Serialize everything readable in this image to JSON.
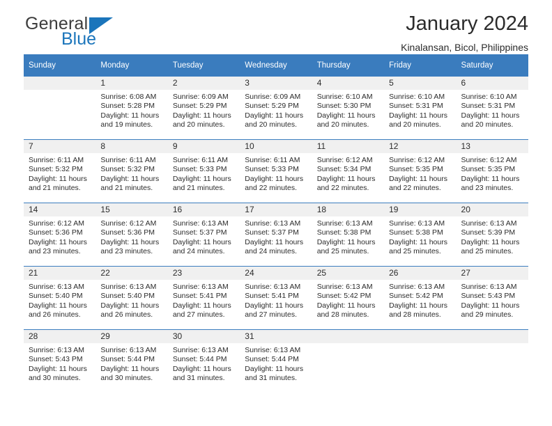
{
  "brand": {
    "word1": "General",
    "word2": "Blue",
    "triangle_icon": "brand-triangle-icon",
    "accent_color": "#1b75bb"
  },
  "header": {
    "title": "January 2024",
    "subtitle": "Kinalansan, Bicol, Philippines"
  },
  "theme": {
    "header_bg": "#3a7cbe",
    "header_text": "#ffffff",
    "daynum_bg": "#f0f0f0",
    "body_text": "#2b2b2b"
  },
  "weekday_headers": [
    "Sunday",
    "Monday",
    "Tuesday",
    "Wednesday",
    "Thursday",
    "Friday",
    "Saturday"
  ],
  "labels": {
    "sunrise_prefix": "Sunrise: ",
    "sunset_prefix": "Sunset: ",
    "daylight_prefix": "Daylight: "
  },
  "weeks": [
    [
      {
        "day": "",
        "sunrise": "",
        "sunset": "",
        "daylight_line1": "",
        "daylight_line2": ""
      },
      {
        "day": "1",
        "sunrise": "Sunrise: 6:08 AM",
        "sunset": "Sunset: 5:28 PM",
        "daylight_line1": "Daylight: 11 hours",
        "daylight_line2": "and 19 minutes."
      },
      {
        "day": "2",
        "sunrise": "Sunrise: 6:09 AM",
        "sunset": "Sunset: 5:29 PM",
        "daylight_line1": "Daylight: 11 hours",
        "daylight_line2": "and 20 minutes."
      },
      {
        "day": "3",
        "sunrise": "Sunrise: 6:09 AM",
        "sunset": "Sunset: 5:29 PM",
        "daylight_line1": "Daylight: 11 hours",
        "daylight_line2": "and 20 minutes."
      },
      {
        "day": "4",
        "sunrise": "Sunrise: 6:10 AM",
        "sunset": "Sunset: 5:30 PM",
        "daylight_line1": "Daylight: 11 hours",
        "daylight_line2": "and 20 minutes."
      },
      {
        "day": "5",
        "sunrise": "Sunrise: 6:10 AM",
        "sunset": "Sunset: 5:31 PM",
        "daylight_line1": "Daylight: 11 hours",
        "daylight_line2": "and 20 minutes."
      },
      {
        "day": "6",
        "sunrise": "Sunrise: 6:10 AM",
        "sunset": "Sunset: 5:31 PM",
        "daylight_line1": "Daylight: 11 hours",
        "daylight_line2": "and 20 minutes."
      }
    ],
    [
      {
        "day": "7",
        "sunrise": "Sunrise: 6:11 AM",
        "sunset": "Sunset: 5:32 PM",
        "daylight_line1": "Daylight: 11 hours",
        "daylight_line2": "and 21 minutes."
      },
      {
        "day": "8",
        "sunrise": "Sunrise: 6:11 AM",
        "sunset": "Sunset: 5:32 PM",
        "daylight_line1": "Daylight: 11 hours",
        "daylight_line2": "and 21 minutes."
      },
      {
        "day": "9",
        "sunrise": "Sunrise: 6:11 AM",
        "sunset": "Sunset: 5:33 PM",
        "daylight_line1": "Daylight: 11 hours",
        "daylight_line2": "and 21 minutes."
      },
      {
        "day": "10",
        "sunrise": "Sunrise: 6:11 AM",
        "sunset": "Sunset: 5:33 PM",
        "daylight_line1": "Daylight: 11 hours",
        "daylight_line2": "and 22 minutes."
      },
      {
        "day": "11",
        "sunrise": "Sunrise: 6:12 AM",
        "sunset": "Sunset: 5:34 PM",
        "daylight_line1": "Daylight: 11 hours",
        "daylight_line2": "and 22 minutes."
      },
      {
        "day": "12",
        "sunrise": "Sunrise: 6:12 AM",
        "sunset": "Sunset: 5:35 PM",
        "daylight_line1": "Daylight: 11 hours",
        "daylight_line2": "and 22 minutes."
      },
      {
        "day": "13",
        "sunrise": "Sunrise: 6:12 AM",
        "sunset": "Sunset: 5:35 PM",
        "daylight_line1": "Daylight: 11 hours",
        "daylight_line2": "and 23 minutes."
      }
    ],
    [
      {
        "day": "14",
        "sunrise": "Sunrise: 6:12 AM",
        "sunset": "Sunset: 5:36 PM",
        "daylight_line1": "Daylight: 11 hours",
        "daylight_line2": "and 23 minutes."
      },
      {
        "day": "15",
        "sunrise": "Sunrise: 6:12 AM",
        "sunset": "Sunset: 5:36 PM",
        "daylight_line1": "Daylight: 11 hours",
        "daylight_line2": "and 23 minutes."
      },
      {
        "day": "16",
        "sunrise": "Sunrise: 6:13 AM",
        "sunset": "Sunset: 5:37 PM",
        "daylight_line1": "Daylight: 11 hours",
        "daylight_line2": "and 24 minutes."
      },
      {
        "day": "17",
        "sunrise": "Sunrise: 6:13 AM",
        "sunset": "Sunset: 5:37 PM",
        "daylight_line1": "Daylight: 11 hours",
        "daylight_line2": "and 24 minutes."
      },
      {
        "day": "18",
        "sunrise": "Sunrise: 6:13 AM",
        "sunset": "Sunset: 5:38 PM",
        "daylight_line1": "Daylight: 11 hours",
        "daylight_line2": "and 25 minutes."
      },
      {
        "day": "19",
        "sunrise": "Sunrise: 6:13 AM",
        "sunset": "Sunset: 5:38 PM",
        "daylight_line1": "Daylight: 11 hours",
        "daylight_line2": "and 25 minutes."
      },
      {
        "day": "20",
        "sunrise": "Sunrise: 6:13 AM",
        "sunset": "Sunset: 5:39 PM",
        "daylight_line1": "Daylight: 11 hours",
        "daylight_line2": "and 25 minutes."
      }
    ],
    [
      {
        "day": "21",
        "sunrise": "Sunrise: 6:13 AM",
        "sunset": "Sunset: 5:40 PM",
        "daylight_line1": "Daylight: 11 hours",
        "daylight_line2": "and 26 minutes."
      },
      {
        "day": "22",
        "sunrise": "Sunrise: 6:13 AM",
        "sunset": "Sunset: 5:40 PM",
        "daylight_line1": "Daylight: 11 hours",
        "daylight_line2": "and 26 minutes."
      },
      {
        "day": "23",
        "sunrise": "Sunrise: 6:13 AM",
        "sunset": "Sunset: 5:41 PM",
        "daylight_line1": "Daylight: 11 hours",
        "daylight_line2": "and 27 minutes."
      },
      {
        "day": "24",
        "sunrise": "Sunrise: 6:13 AM",
        "sunset": "Sunset: 5:41 PM",
        "daylight_line1": "Daylight: 11 hours",
        "daylight_line2": "and 27 minutes."
      },
      {
        "day": "25",
        "sunrise": "Sunrise: 6:13 AM",
        "sunset": "Sunset: 5:42 PM",
        "daylight_line1": "Daylight: 11 hours",
        "daylight_line2": "and 28 minutes."
      },
      {
        "day": "26",
        "sunrise": "Sunrise: 6:13 AM",
        "sunset": "Sunset: 5:42 PM",
        "daylight_line1": "Daylight: 11 hours",
        "daylight_line2": "and 28 minutes."
      },
      {
        "day": "27",
        "sunrise": "Sunrise: 6:13 AM",
        "sunset": "Sunset: 5:43 PM",
        "daylight_line1": "Daylight: 11 hours",
        "daylight_line2": "and 29 minutes."
      }
    ],
    [
      {
        "day": "28",
        "sunrise": "Sunrise: 6:13 AM",
        "sunset": "Sunset: 5:43 PM",
        "daylight_line1": "Daylight: 11 hours",
        "daylight_line2": "and 30 minutes."
      },
      {
        "day": "29",
        "sunrise": "Sunrise: 6:13 AM",
        "sunset": "Sunset: 5:44 PM",
        "daylight_line1": "Daylight: 11 hours",
        "daylight_line2": "and 30 minutes."
      },
      {
        "day": "30",
        "sunrise": "Sunrise: 6:13 AM",
        "sunset": "Sunset: 5:44 PM",
        "daylight_line1": "Daylight: 11 hours",
        "daylight_line2": "and 31 minutes."
      },
      {
        "day": "31",
        "sunrise": "Sunrise: 6:13 AM",
        "sunset": "Sunset: 5:44 PM",
        "daylight_line1": "Daylight: 11 hours",
        "daylight_line2": "and 31 minutes."
      },
      {
        "day": "",
        "sunrise": "",
        "sunset": "",
        "daylight_line1": "",
        "daylight_line2": ""
      },
      {
        "day": "",
        "sunrise": "",
        "sunset": "",
        "daylight_line1": "",
        "daylight_line2": ""
      },
      {
        "day": "",
        "sunrise": "",
        "sunset": "",
        "daylight_line1": "",
        "daylight_line2": ""
      }
    ]
  ]
}
